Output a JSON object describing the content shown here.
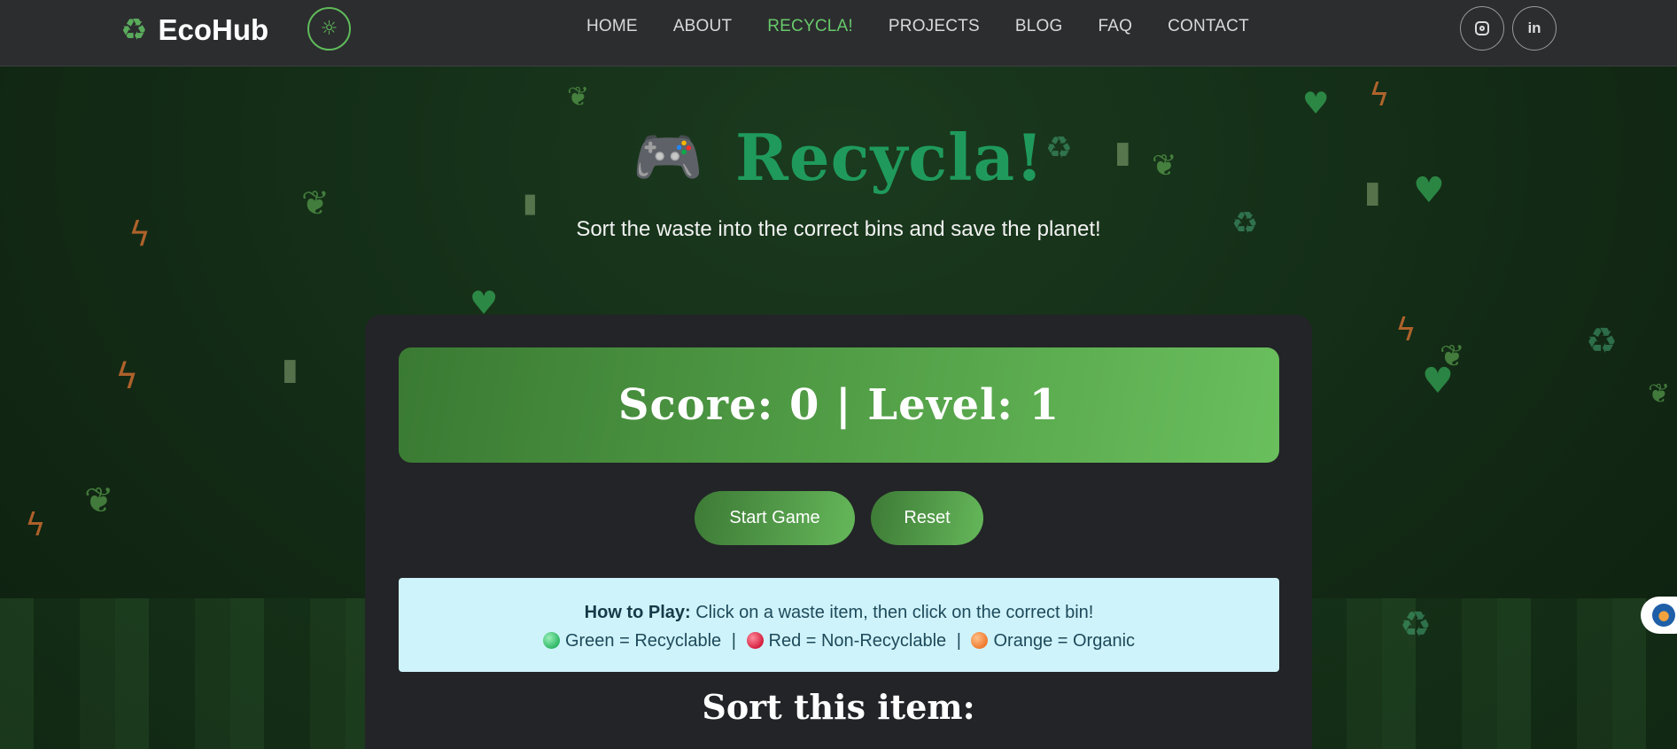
{
  "brand": {
    "name": "EcoHub",
    "icon": "recycle-icon"
  },
  "theme_toggle": {
    "icon": "sun-icon"
  },
  "nav": {
    "items": [
      {
        "label": "HOME"
      },
      {
        "label": "ABOUT"
      },
      {
        "label": "RECYCLA!"
      },
      {
        "label": "PROJECTS"
      },
      {
        "label": "BLOG"
      },
      {
        "label": "FAQ"
      },
      {
        "label": "CONTACT"
      }
    ],
    "active": "RECYCLA!"
  },
  "social": {
    "instagram_icon": "instagram-icon",
    "linkedin_label": "in"
  },
  "hero": {
    "icon": "game-controller-icon",
    "title": "Recycla!",
    "subtitle": "Sort the waste into the correct bins and save the planet!"
  },
  "game": {
    "scoreboard": "Score: 0 | Level: 1",
    "start_label": "Start Game",
    "reset_label": "Reset",
    "howto": {
      "heading": "How to Play:",
      "text": "Click on a waste item, then click on the correct bin!",
      "legend": [
        {
          "color": "green",
          "label": "Green = Recyclable"
        },
        {
          "color": "red",
          "label": "Red = Non-Recyclable"
        },
        {
          "color": "orange",
          "label": "Orange = Organic"
        }
      ]
    },
    "sort_title": "Sort this item:"
  },
  "colors": {
    "accent": "#67c96a",
    "title": "#1f9a5c",
    "nav_bg": "#2c2d2f",
    "card_bg": "#222427",
    "info_bg": "#cff3fb"
  }
}
